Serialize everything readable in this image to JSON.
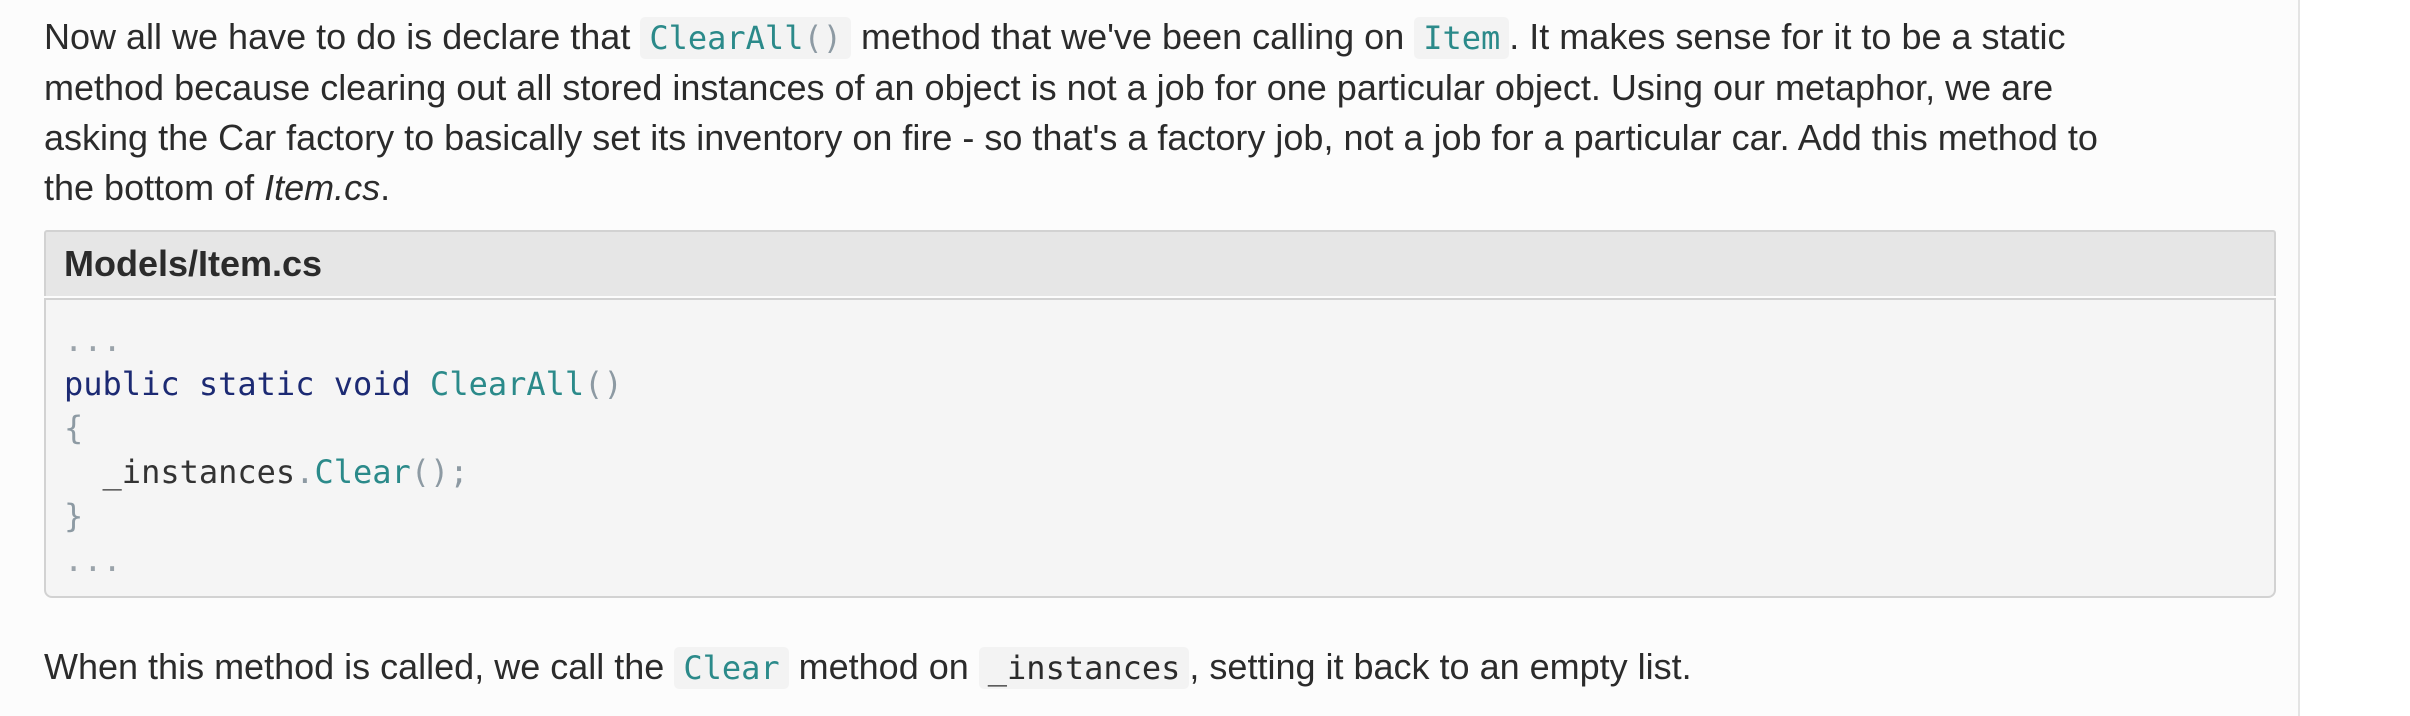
{
  "paragraph_1": {
    "line1_a": "Now all we have to do is declare that ",
    "code_clearall_name": "ClearAll",
    "code_clearall_parens": "()",
    "line1_b": " method that we've been calling on ",
    "code_item": "Item",
    "line1_c": ". It makes sense for it to be a static",
    "line2": "method because clearing out all stored instances of an object is not a job for one particular object. Using our metaphor, we are",
    "line3": "asking the Car factory to basically set its inventory on fire - so that's a factory job, not a job for a particular car. Add this method to",
    "line4_a": "the bottom of ",
    "line4_em": "Item.cs",
    "line4_b": "."
  },
  "code_example": {
    "file_name": "Models/Item.cs",
    "ellipsis_top": "...",
    "kw_public": "public",
    "kw_static": "static",
    "kw_void": "void",
    "method_name": "ClearAll",
    "method_parens": "()",
    "open_brace": "{",
    "body_indent": "  ",
    "body_object": "_instances",
    "body_dot": ".",
    "body_method": "Clear",
    "body_tail": "();",
    "close_brace": "}",
    "ellipsis_bottom": "..."
  },
  "paragraph_2": {
    "text_a": "When this method is called, we call the ",
    "code_clear": "Clear",
    "text_b": " method on ",
    "code_instances": "_instances",
    "text_c": ", setting it back to an empty list."
  }
}
